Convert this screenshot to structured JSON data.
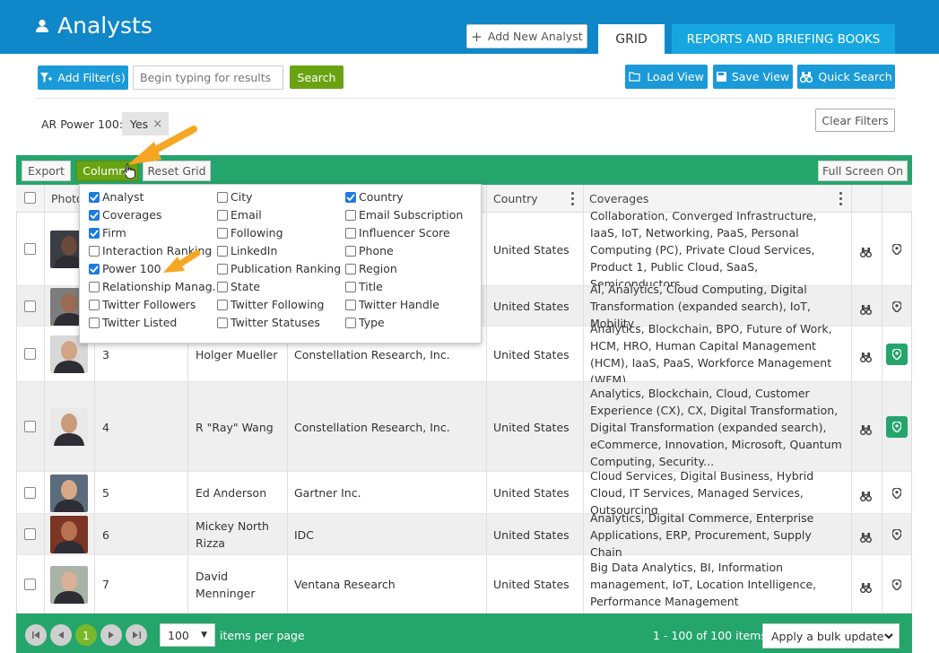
{
  "header": {
    "title": "Analysts",
    "add_button": "Add New Analyst",
    "tabs": [
      "GRID",
      "REPORTS AND BRIEFING BOOKS"
    ]
  },
  "filter_bar": {
    "add_filter": "Add Filter(s)",
    "search_placeholder": "Begin typing for results",
    "search_button": "Search",
    "load_view": "Load View",
    "save_view": "Save View",
    "quick_search": "Quick Search"
  },
  "active_filter": {
    "label": "AR Power 100:",
    "value": "Yes"
  },
  "clear_filters": "Clear Filters",
  "toolbar": {
    "export": "Export",
    "columns": "Columns",
    "reset_grid": "Reset Grid",
    "full_screen": "Full Screen On"
  },
  "table": {
    "headers": [
      "Photo",
      "Country",
      "Coverages"
    ],
    "rows": [
      {
        "num": "",
        "name": "",
        "firm": "",
        "country": "United States",
        "coverages": "Collaboration, Converged Infrastructure, IaaS, IoT, Networking, PaaS, Personal Computing (PC), Private Cloud Services, Product 1, Public Cloud, SaaS, Semiconductors...",
        "pinned": false
      },
      {
        "num": "",
        "name": "",
        "firm": "",
        "country": "United States",
        "coverages": "AI, Analytics, Cloud Computing, Digital Transformation (expanded search), IoT, Mobility",
        "pinned": false
      },
      {
        "num": "3",
        "name": "Holger Mueller",
        "firm": "Constellation Research, Inc.",
        "country": "United States",
        "coverages": "Analytics, Blockchain, BPO, Future of Work, HCM, HRO, Human Capital Management (HCM), IaaS, PaaS, Workforce Management (WFM)",
        "pinned": true
      },
      {
        "num": "4",
        "name": "R \"Ray\" Wang",
        "firm": "Constellation Research, Inc.",
        "country": "United States",
        "coverages": "Analytics, Blockchain, Cloud, Customer Experience (CX), CX, Digital Transformation, Digital Transformation (expanded search), eCommerce, Innovation, Microsoft, Quantum Computing, Security...",
        "pinned": true
      },
      {
        "num": "5",
        "name": "Ed Anderson",
        "firm": "Gartner Inc.",
        "country": "United States",
        "coverages": "Cloud Services, Digital Business, Hybrid Cloud, IT Services, Managed Services, Outsourcing",
        "pinned": false
      },
      {
        "num": "6",
        "name": "Mickey North Rizza",
        "firm": "IDC",
        "country": "United States",
        "coverages": "Analytics, Digital Commerce, Enterprise Applications, ERP, Procurement, Supply Chain",
        "pinned": false
      },
      {
        "num": "7",
        "name": "David Menninger",
        "firm": "Ventana Research",
        "country": "United States",
        "coverages": "Big Data Analytics, BI, Information management, IoT, Location Intelligence, Performance Management",
        "pinned": false
      }
    ]
  },
  "columns_menu": {
    "col1": [
      {
        "label": "Analyst",
        "checked": true
      },
      {
        "label": "Coverages",
        "checked": true
      },
      {
        "label": "Firm",
        "checked": true
      },
      {
        "label": "Interaction Ranking",
        "checked": false
      },
      {
        "label": "Power 100",
        "checked": true
      },
      {
        "label": "Relationship Manag...",
        "checked": false
      },
      {
        "label": "Twitter Followers",
        "checked": false
      },
      {
        "label": "Twitter Listed",
        "checked": false
      }
    ],
    "col2": [
      {
        "label": "City",
        "checked": false
      },
      {
        "label": "Email",
        "checked": false
      },
      {
        "label": "Following",
        "checked": false
      },
      {
        "label": "LinkedIn",
        "checked": false
      },
      {
        "label": "Publication Ranking",
        "checked": false
      },
      {
        "label": "State",
        "checked": false
      },
      {
        "label": "Twitter Following",
        "checked": false
      },
      {
        "label": "Twitter Statuses",
        "checked": false
      }
    ],
    "col3": [
      {
        "label": "Country",
        "checked": true
      },
      {
        "label": "Email Subscription",
        "checked": false
      },
      {
        "label": "Influencer Score",
        "checked": false
      },
      {
        "label": "Phone",
        "checked": false
      },
      {
        "label": "Region",
        "checked": false
      },
      {
        "label": "Title",
        "checked": false
      },
      {
        "label": "Twitter Handle",
        "checked": false
      },
      {
        "label": "Type",
        "checked": false
      }
    ]
  },
  "pagination": {
    "current_page": "1",
    "per_page": "100",
    "items_per_page_label": "items per page",
    "range": "1 - 100 of 100 items",
    "bulk_update": "Apply a bulk update"
  },
  "colors": {
    "header_blue": "#0f87c9",
    "tab_blue": "#16a7e1",
    "grid_green": "#24a56b",
    "search_green": "#6aa312",
    "pin_active": "#24a56b",
    "arrow_orange": "#f5a623"
  }
}
